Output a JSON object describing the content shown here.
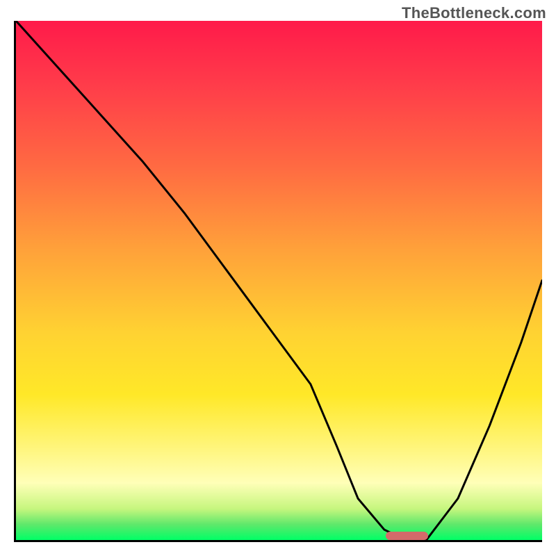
{
  "watermark": "TheBottleneck.com",
  "colors": {
    "border": "#000000",
    "curve": "#000000",
    "marker": "#d46a6a",
    "gradient_stops": [
      "#ff1a4a",
      "#ff3b4a",
      "#ff6a42",
      "#ffa13a",
      "#ffd232",
      "#ffe828",
      "#fff57a",
      "#ffffb8",
      "#c6f67e",
      "#5fe86b",
      "#00ff66"
    ]
  },
  "chart_data": {
    "type": "line",
    "title": "",
    "xlabel": "",
    "ylabel": "",
    "xlim": [
      0,
      100
    ],
    "ylim": [
      0,
      100
    ],
    "grid": false,
    "legend": false,
    "series": [
      {
        "name": "bottleneck-curve",
        "x": [
          0,
          8,
          16,
          24,
          32,
          40,
          48,
          56,
          61,
          65,
          70,
          74,
          78,
          84,
          90,
          96,
          100
        ],
        "values": [
          100,
          91,
          82,
          73,
          63,
          52,
          41,
          30,
          18,
          8,
          2,
          0,
          0,
          8,
          22,
          38,
          50
        ]
      }
    ],
    "annotations": [
      {
        "name": "optimal-marker",
        "x_range": [
          70,
          78
        ],
        "y": 0
      }
    ]
  }
}
